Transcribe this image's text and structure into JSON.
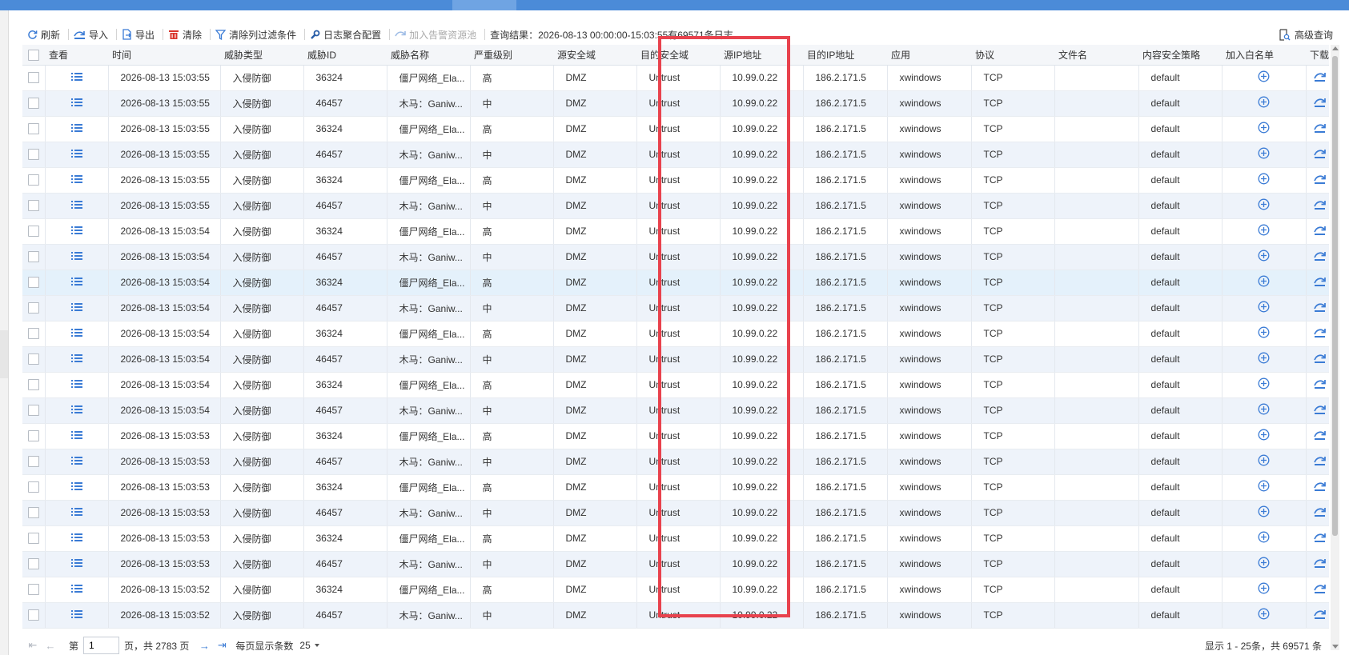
{
  "toolbar": {
    "refresh": "刷新",
    "import": "导入",
    "export": "导出",
    "clear": "清除",
    "clear_filters": "清除列过滤条件",
    "log_aggregation": "日志聚合配置",
    "add_alert_pool": "加入告警资源池",
    "query_result": "查询结果：2026-08-13 00:00:00-15:03:55有69571条日志",
    "advanced_query": "高级查询"
  },
  "columns": [
    "查看",
    "时间",
    "威胁类型",
    "威胁ID",
    "威胁名称",
    "严重级别",
    "源安全域",
    "目的安全域",
    "源IP地址",
    "目的IP地址",
    "应用",
    "协议",
    "文件名",
    "内容安全策略",
    "加入白名单",
    "下载"
  ],
  "rows": [
    {
      "time": "2026-08-13 15:03:55",
      "type": "入侵防御",
      "id": "36324",
      "name": "僵尸网络_Ela...",
      "sev": "高",
      "src_zone": "DMZ",
      "dst_zone": "Untrust",
      "src_ip": "10.99.0.22",
      "dst_ip": "186.2.171.5",
      "app": "xwindows",
      "proto": "TCP",
      "file": "",
      "policy": "default"
    },
    {
      "time": "2026-08-13 15:03:55",
      "type": "入侵防御",
      "id": "46457",
      "name": "木马：Ganiw...",
      "sev": "中",
      "src_zone": "DMZ",
      "dst_zone": "Untrust",
      "src_ip": "10.99.0.22",
      "dst_ip": "186.2.171.5",
      "app": "xwindows",
      "proto": "TCP",
      "file": "",
      "policy": "default"
    },
    {
      "time": "2026-08-13 15:03:55",
      "type": "入侵防御",
      "id": "36324",
      "name": "僵尸网络_Ela...",
      "sev": "高",
      "src_zone": "DMZ",
      "dst_zone": "Untrust",
      "src_ip": "10.99.0.22",
      "dst_ip": "186.2.171.5",
      "app": "xwindows",
      "proto": "TCP",
      "file": "",
      "policy": "default"
    },
    {
      "time": "2026-08-13 15:03:55",
      "type": "入侵防御",
      "id": "46457",
      "name": "木马：Ganiw...",
      "sev": "中",
      "src_zone": "DMZ",
      "dst_zone": "Untrust",
      "src_ip": "10.99.0.22",
      "dst_ip": "186.2.171.5",
      "app": "xwindows",
      "proto": "TCP",
      "file": "",
      "policy": "default"
    },
    {
      "time": "2026-08-13 15:03:55",
      "type": "入侵防御",
      "id": "36324",
      "name": "僵尸网络_Ela...",
      "sev": "高",
      "src_zone": "DMZ",
      "dst_zone": "Untrust",
      "src_ip": "10.99.0.22",
      "dst_ip": "186.2.171.5",
      "app": "xwindows",
      "proto": "TCP",
      "file": "",
      "policy": "default"
    },
    {
      "time": "2026-08-13 15:03:55",
      "type": "入侵防御",
      "id": "46457",
      "name": "木马：Ganiw...",
      "sev": "中",
      "src_zone": "DMZ",
      "dst_zone": "Untrust",
      "src_ip": "10.99.0.22",
      "dst_ip": "186.2.171.5",
      "app": "xwindows",
      "proto": "TCP",
      "file": "",
      "policy": "default"
    },
    {
      "time": "2026-08-13 15:03:54",
      "type": "入侵防御",
      "id": "36324",
      "name": "僵尸网络_Ela...",
      "sev": "高",
      "src_zone": "DMZ",
      "dst_zone": "Untrust",
      "src_ip": "10.99.0.22",
      "dst_ip": "186.2.171.5",
      "app": "xwindows",
      "proto": "TCP",
      "file": "",
      "policy": "default"
    },
    {
      "time": "2026-08-13 15:03:54",
      "type": "入侵防御",
      "id": "46457",
      "name": "木马：Ganiw...",
      "sev": "中",
      "src_zone": "DMZ",
      "dst_zone": "Untrust",
      "src_ip": "10.99.0.22",
      "dst_ip": "186.2.171.5",
      "app": "xwindows",
      "proto": "TCP",
      "file": "",
      "policy": "default"
    },
    {
      "time": "2026-08-13 15:03:54",
      "type": "入侵防御",
      "id": "36324",
      "name": "僵尸网络_Ela...",
      "sev": "高",
      "src_zone": "DMZ",
      "dst_zone": "Untrust",
      "src_ip": "10.99.0.22",
      "dst_ip": "186.2.171.5",
      "app": "xwindows",
      "proto": "TCP",
      "file": "",
      "policy": "default"
    },
    {
      "time": "2026-08-13 15:03:54",
      "type": "入侵防御",
      "id": "46457",
      "name": "木马：Ganiw...",
      "sev": "中",
      "src_zone": "DMZ",
      "dst_zone": "Untrust",
      "src_ip": "10.99.0.22",
      "dst_ip": "186.2.171.5",
      "app": "xwindows",
      "proto": "TCP",
      "file": "",
      "policy": "default"
    },
    {
      "time": "2026-08-13 15:03:54",
      "type": "入侵防御",
      "id": "36324",
      "name": "僵尸网络_Ela...",
      "sev": "高",
      "src_zone": "DMZ",
      "dst_zone": "Untrust",
      "src_ip": "10.99.0.22",
      "dst_ip": "186.2.171.5",
      "app": "xwindows",
      "proto": "TCP",
      "file": "",
      "policy": "default"
    },
    {
      "time": "2026-08-13 15:03:54",
      "type": "入侵防御",
      "id": "46457",
      "name": "木马：Ganiw...",
      "sev": "中",
      "src_zone": "DMZ",
      "dst_zone": "Untrust",
      "src_ip": "10.99.0.22",
      "dst_ip": "186.2.171.5",
      "app": "xwindows",
      "proto": "TCP",
      "file": "",
      "policy": "default"
    },
    {
      "time": "2026-08-13 15:03:54",
      "type": "入侵防御",
      "id": "36324",
      "name": "僵尸网络_Ela...",
      "sev": "高",
      "src_zone": "DMZ",
      "dst_zone": "Untrust",
      "src_ip": "10.99.0.22",
      "dst_ip": "186.2.171.5",
      "app": "xwindows",
      "proto": "TCP",
      "file": "",
      "policy": "default"
    },
    {
      "time": "2026-08-13 15:03:54",
      "type": "入侵防御",
      "id": "46457",
      "name": "木马：Ganiw...",
      "sev": "中",
      "src_zone": "DMZ",
      "dst_zone": "Untrust",
      "src_ip": "10.99.0.22",
      "dst_ip": "186.2.171.5",
      "app": "xwindows",
      "proto": "TCP",
      "file": "",
      "policy": "default"
    },
    {
      "time": "2026-08-13 15:03:53",
      "type": "入侵防御",
      "id": "36324",
      "name": "僵尸网络_Ela...",
      "sev": "高",
      "src_zone": "DMZ",
      "dst_zone": "Untrust",
      "src_ip": "10.99.0.22",
      "dst_ip": "186.2.171.5",
      "app": "xwindows",
      "proto": "TCP",
      "file": "",
      "policy": "default"
    },
    {
      "time": "2026-08-13 15:03:53",
      "type": "入侵防御",
      "id": "46457",
      "name": "木马：Ganiw...",
      "sev": "中",
      "src_zone": "DMZ",
      "dst_zone": "Untrust",
      "src_ip": "10.99.0.22",
      "dst_ip": "186.2.171.5",
      "app": "xwindows",
      "proto": "TCP",
      "file": "",
      "policy": "default"
    },
    {
      "time": "2026-08-13 15:03:53",
      "type": "入侵防御",
      "id": "36324",
      "name": "僵尸网络_Ela...",
      "sev": "高",
      "src_zone": "DMZ",
      "dst_zone": "Untrust",
      "src_ip": "10.99.0.22",
      "dst_ip": "186.2.171.5",
      "app": "xwindows",
      "proto": "TCP",
      "file": "",
      "policy": "default"
    },
    {
      "time": "2026-08-13 15:03:53",
      "type": "入侵防御",
      "id": "46457",
      "name": "木马：Ganiw...",
      "sev": "中",
      "src_zone": "DMZ",
      "dst_zone": "Untrust",
      "src_ip": "10.99.0.22",
      "dst_ip": "186.2.171.5",
      "app": "xwindows",
      "proto": "TCP",
      "file": "",
      "policy": "default"
    },
    {
      "time": "2026-08-13 15:03:53",
      "type": "入侵防御",
      "id": "36324",
      "name": "僵尸网络_Ela...",
      "sev": "高",
      "src_zone": "DMZ",
      "dst_zone": "Untrust",
      "src_ip": "10.99.0.22",
      "dst_ip": "186.2.171.5",
      "app": "xwindows",
      "proto": "TCP",
      "file": "",
      "policy": "default"
    },
    {
      "time": "2026-08-13 15:03:53",
      "type": "入侵防御",
      "id": "46457",
      "name": "木马：Ganiw...",
      "sev": "中",
      "src_zone": "DMZ",
      "dst_zone": "Untrust",
      "src_ip": "10.99.0.22",
      "dst_ip": "186.2.171.5",
      "app": "xwindows",
      "proto": "TCP",
      "file": "",
      "policy": "default"
    },
    {
      "time": "2026-08-13 15:03:52",
      "type": "入侵防御",
      "id": "36324",
      "name": "僵尸网络_Ela...",
      "sev": "高",
      "src_zone": "DMZ",
      "dst_zone": "Untrust",
      "src_ip": "10.99.0.22",
      "dst_ip": "186.2.171.5",
      "app": "xwindows",
      "proto": "TCP",
      "file": "",
      "policy": "default"
    },
    {
      "time": "2026-08-13 15:03:52",
      "type": "入侵防御",
      "id": "46457",
      "name": "木马：Ganiw...",
      "sev": "中",
      "src_zone": "DMZ",
      "dst_zone": "Untrust",
      "src_ip": "10.99.0.22",
      "dst_ip": "186.2.171.5",
      "app": "xwindows",
      "proto": "TCP",
      "file": "",
      "policy": "default"
    }
  ],
  "highlighted_row": 8,
  "pager": {
    "page_prefix": "第",
    "page_value": "1",
    "page_suffix": "页，共 2783 页",
    "page_size_label": "每页显示条数",
    "page_size_value": "25",
    "summary": "显示 1 - 25条，共 69571 条"
  },
  "icons": {
    "refresh": "refresh-icon",
    "import": "import-icon",
    "export": "export-icon",
    "clear": "trash-icon",
    "clear_filters": "filter-icon",
    "log_aggregation": "wrench-icon",
    "add_alert_pool": "pool-icon",
    "advanced_query": "search-doc-icon",
    "view": "list-icon",
    "whitelist": "plus-circle-icon",
    "download": "download-icon"
  },
  "colors": {
    "accent": "#3a7bd5",
    "header_bar": "#4b8bd8",
    "clear_red": "#d9342b",
    "highlight_box": "#e8424d"
  }
}
